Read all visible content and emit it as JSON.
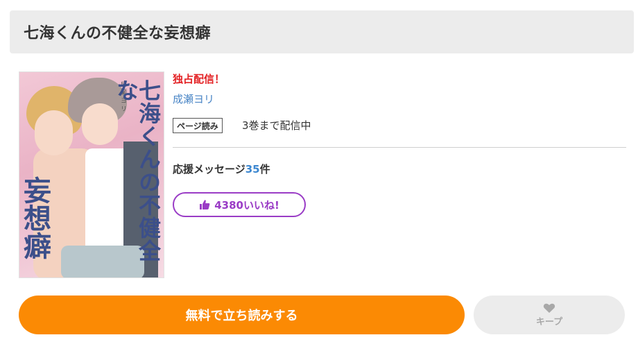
{
  "header": {
    "title": "七海くんの不健全な妄想癖"
  },
  "cover": {
    "title_vertical": "七海くんの不健全な",
    "title_vertical_2": "妄想癖",
    "author_vertical": "成瀬ヨリ"
  },
  "info": {
    "exclusive": "独占配信！",
    "author": "成瀬ヨリ",
    "format_badge": "ページ読み",
    "volumes_text": "3巻まで配信中",
    "support_label": "応援メッセージ",
    "support_count": "35",
    "support_suffix": "件",
    "like_label": "4380いいね!"
  },
  "actions": {
    "read_label": "無料で立ち読みする",
    "keep_label": "キープ"
  },
  "colors": {
    "accent_orange": "#fb8a04",
    "like_purple": "#9a3cc6",
    "exclusive_red": "#e32124",
    "link_blue": "#4a86c6"
  },
  "icons": {
    "like": "thumbs-up-icon",
    "keep": "heart-icon"
  }
}
